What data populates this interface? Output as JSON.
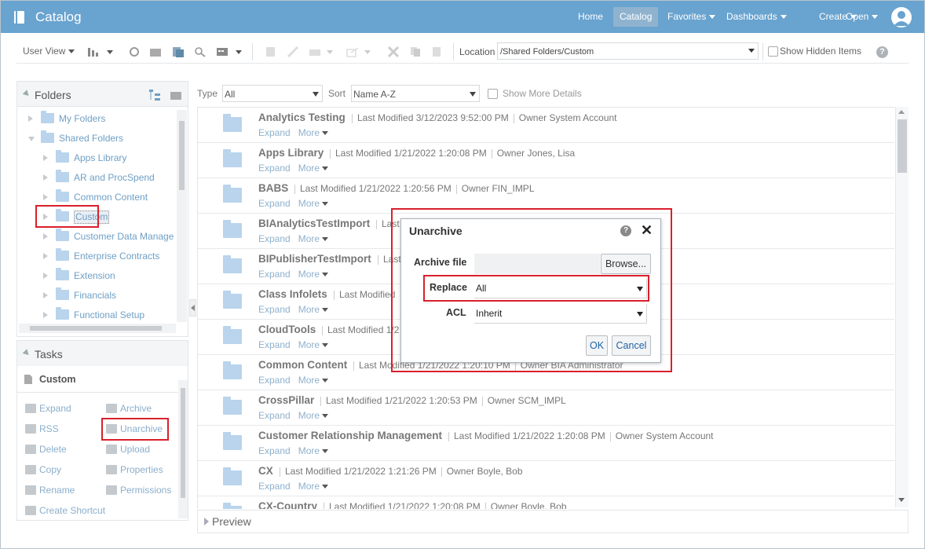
{
  "app": {
    "title": "Catalog",
    "nav": [
      {
        "label": "Home",
        "has_menu": false,
        "active": false
      },
      {
        "label": "Catalog",
        "has_menu": false,
        "active": true
      },
      {
        "label": "Favorites",
        "has_menu": true,
        "active": false
      },
      {
        "label": "Dashboards",
        "has_menu": true,
        "active": false
      },
      {
        "label": "Create",
        "has_menu": true,
        "active": false
      },
      {
        "label": "Open",
        "has_menu": true,
        "active": false
      }
    ],
    "user_icon": "user-avatar-icon"
  },
  "toolbar": {
    "user_view_label": "User View",
    "location_label": "Location",
    "location_value": "/Shared Folders/Custom",
    "show_hidden_label": "Show Hidden Items",
    "help_glyph": "?"
  },
  "folders_panel": {
    "title": "Folders",
    "items": [
      {
        "label": "My Folders",
        "expanded": false
      },
      {
        "label": "Shared Folders",
        "expanded": true
      },
      {
        "label": "Apps Library",
        "expanded": false
      },
      {
        "label": "AR and ProcSpend",
        "expanded": false
      },
      {
        "label": "Common Content",
        "expanded": false
      },
      {
        "label": "Custom",
        "expanded": false,
        "selected": true
      },
      {
        "label": "Customer Data Manage",
        "expanded": false
      },
      {
        "label": "Enterprise Contracts",
        "expanded": false
      },
      {
        "label": "Extension",
        "expanded": false
      },
      {
        "label": "Financials",
        "expanded": false
      },
      {
        "label": "Functional Setup",
        "expanded": false
      }
    ]
  },
  "tasks_panel": {
    "title": "Tasks",
    "context": "Custom",
    "links": [
      {
        "label": "Expand",
        "icon": "folder-open-icon"
      },
      {
        "label": "Archive",
        "icon": "archive-icon"
      },
      {
        "label": "RSS",
        "icon": "rss-icon"
      },
      {
        "label": "Unarchive",
        "icon": "unarchive-icon"
      },
      {
        "label": "Delete",
        "icon": "delete-icon"
      },
      {
        "label": "Upload",
        "icon": "upload-icon"
      },
      {
        "label": "Copy",
        "icon": "copy-icon"
      },
      {
        "label": "Properties",
        "icon": "properties-icon"
      },
      {
        "label": "Rename",
        "icon": "rename-icon"
      },
      {
        "label": "Permissions",
        "icon": "permissions-icon"
      },
      {
        "label": "Create Shortcut",
        "icon": "shortcut-icon"
      }
    ]
  },
  "filters": {
    "type_label": "Type",
    "type_value": "All",
    "sort_label": "Sort",
    "sort_value": "Name A-Z",
    "more_details_label": "Show More Details"
  },
  "list": {
    "expand_label": "Expand",
    "more_label": "More",
    "rows": [
      {
        "name": "Analytics Testing",
        "modified": "Last Modified 3/12/2023 9:52:00 PM",
        "owner": "Owner System Account"
      },
      {
        "name": "Apps Library",
        "modified": "Last Modified 1/21/2022 1:20:08 PM",
        "owner": "Owner Jones, Lisa"
      },
      {
        "name": "BABS",
        "modified": "Last Modified 1/21/2022 1:20:56 PM",
        "owner": "Owner FIN_IMPL"
      },
      {
        "name": "BIAnalyticsTestImport",
        "modified": "Last",
        "owner": ""
      },
      {
        "name": "BIPublisherTestImport",
        "modified": "Last",
        "owner": ""
      },
      {
        "name": "Class Infolets",
        "modified": "Last Modified",
        "owner": ""
      },
      {
        "name": "CloudTools",
        "modified": "Last Modified 1/2",
        "owner": ""
      },
      {
        "name": "Common Content",
        "modified": "Last Modified 1/21/2022 1:20:10 PM",
        "owner": "Owner BIA Administrator"
      },
      {
        "name": "CrossPillar",
        "modified": "Last Modified 1/21/2022 1:20:53 PM",
        "owner": "Owner SCM_IMPL"
      },
      {
        "name": "Customer Relationship Management",
        "modified": "Last Modified 1/21/2022 1:20:08 PM",
        "owner": "Owner System Account"
      },
      {
        "name": "CX",
        "modified": "Last Modified 1/21/2022 1:21:26 PM",
        "owner": "Owner Boyle, Bob"
      },
      {
        "name": "CX-Country",
        "modified": "Last Modified 1/21/2022 1:20:08 PM",
        "owner": "Owner Boyle, Bob"
      }
    ]
  },
  "preview": {
    "label": "Preview"
  },
  "dialog": {
    "title": "Unarchive",
    "archive_file_label": "Archive file",
    "browse_label": "Browse...",
    "replace_label": "Replace",
    "replace_value": "All",
    "acl_label": "ACL",
    "acl_value": "Inherit",
    "ok_label": "OK",
    "cancel_label": "Cancel",
    "close_glyph": "✕",
    "help_glyph": "?"
  },
  "colors": {
    "header_bar": "#69a3cf",
    "highlight": "#d9202c",
    "link": "#6e9fc5"
  }
}
